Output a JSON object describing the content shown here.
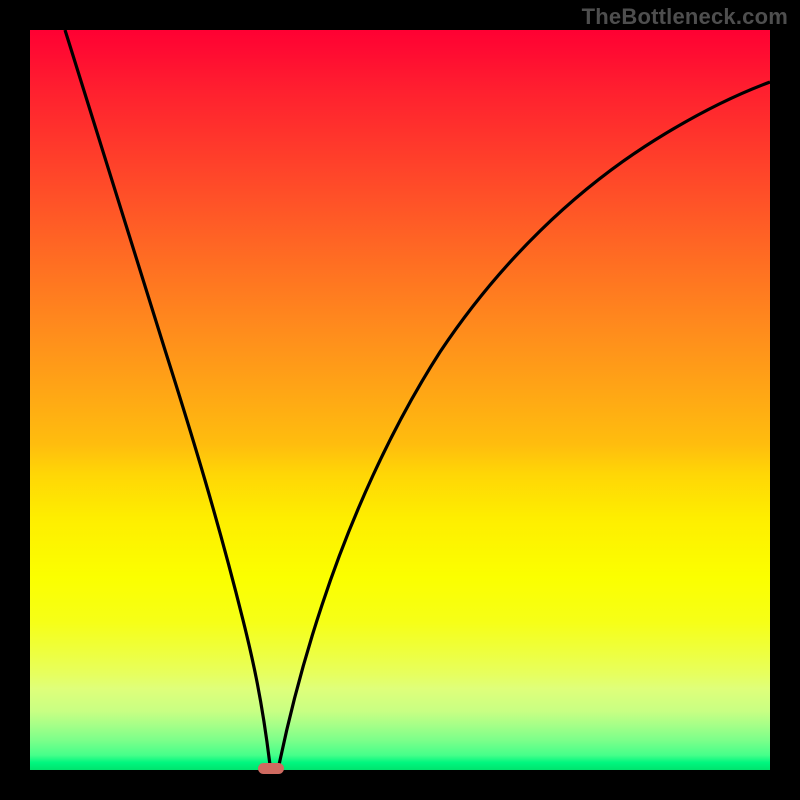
{
  "watermark": "TheBottleneck.com",
  "chart_data": {
    "type": "line",
    "title": "",
    "xlabel": "",
    "ylabel": "",
    "xlim": [
      0,
      100
    ],
    "ylim": [
      0,
      100
    ],
    "background_gradient": {
      "orientation": "vertical",
      "stops": [
        {
          "pct": 0,
          "color": "#ff0033"
        },
        {
          "pct": 25,
          "color": "#ff6a24"
        },
        {
          "pct": 55,
          "color": "#ffcc0b"
        },
        {
          "pct": 80,
          "color": "#f6ff17"
        },
        {
          "pct": 95,
          "color": "#7bff8a"
        },
        {
          "pct": 100,
          "color": "#00e36d"
        }
      ]
    },
    "series": [
      {
        "name": "bottleneck-curve",
        "color": "#000000",
        "x": [
          0,
          5,
          10,
          15,
          20,
          25,
          28,
          30,
          31.6,
          33,
          35,
          38,
          42,
          48,
          55,
          63,
          72,
          82,
          92,
          100
        ],
        "y": [
          100,
          83,
          66,
          50,
          33,
          16,
          6,
          2,
          0,
          2,
          6,
          14,
          24,
          38,
          50,
          60,
          68,
          75,
          80,
          83
        ]
      }
    ],
    "annotations": [
      {
        "name": "minimum-marker",
        "x": 31.6,
        "y": 0,
        "color": "#cf6a60"
      }
    ]
  }
}
